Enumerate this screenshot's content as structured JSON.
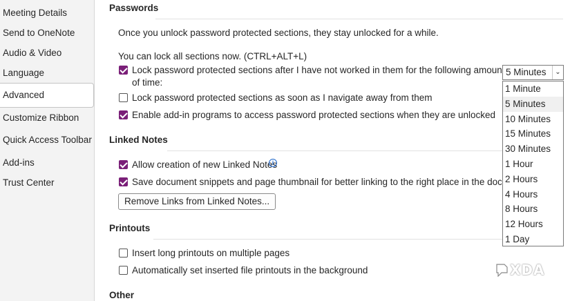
{
  "sidebar": {
    "items": [
      {
        "label": "Meeting Details"
      },
      {
        "label": "Send to OneNote"
      },
      {
        "label": "Audio & Video"
      },
      {
        "label": "Language"
      },
      {
        "label": "Advanced",
        "selected": true
      },
      {
        "label": "Customize Ribbon"
      },
      {
        "label": "Quick Access Toolbar"
      },
      {
        "label": "Add-ins"
      },
      {
        "label": "Trust Center"
      }
    ]
  },
  "passwords": {
    "heading": "Passwords",
    "intro": "Once you unlock password protected sections, they stay unlocked for a while.",
    "lock_now": "You can lock all sections now. (CTRL+ALT+L)",
    "opt_lock_after_line1": "Lock password protected sections after I have not worked in them for the following amount",
    "opt_lock_after_line2": "of time:",
    "opt_lock_after_checked": true,
    "opt_lock_navigate": "Lock password protected sections as soon as I navigate away from them",
    "opt_lock_navigate_checked": false,
    "opt_addins": "Enable add-in programs to access password protected sections when they are unlocked",
    "opt_addins_checked": true,
    "timeout_select": {
      "value": "5 Minutes",
      "options": [
        "1 Minute",
        "5 Minutes",
        "10 Minutes",
        "15 Minutes",
        "30 Minutes",
        "1 Hour",
        "2 Hours",
        "4 Hours",
        "8 Hours",
        "12 Hours",
        "1 Day"
      ],
      "highlighted": "5 Minutes"
    }
  },
  "linked_notes": {
    "heading": "Linked Notes",
    "opt_allow": "Allow creation of new Linked Notes",
    "opt_allow_checked": true,
    "opt_snippets": "Save document snippets and page thumbnail for better linking to the right place in the documen",
    "opt_snippets_checked": true,
    "remove_button": "Remove Links from Linked Notes..."
  },
  "printouts": {
    "heading": "Printouts",
    "opt_long": "Insert long printouts on multiple pages",
    "opt_long_checked": false,
    "opt_background": "Automatically set inserted file printouts in the background",
    "opt_background_checked": false
  },
  "other": {
    "heading": "Other"
  },
  "watermark": {
    "text": "XDA"
  },
  "colors": {
    "checkbox_accent": "#7a1f78",
    "info_icon": "#1c64c8"
  }
}
